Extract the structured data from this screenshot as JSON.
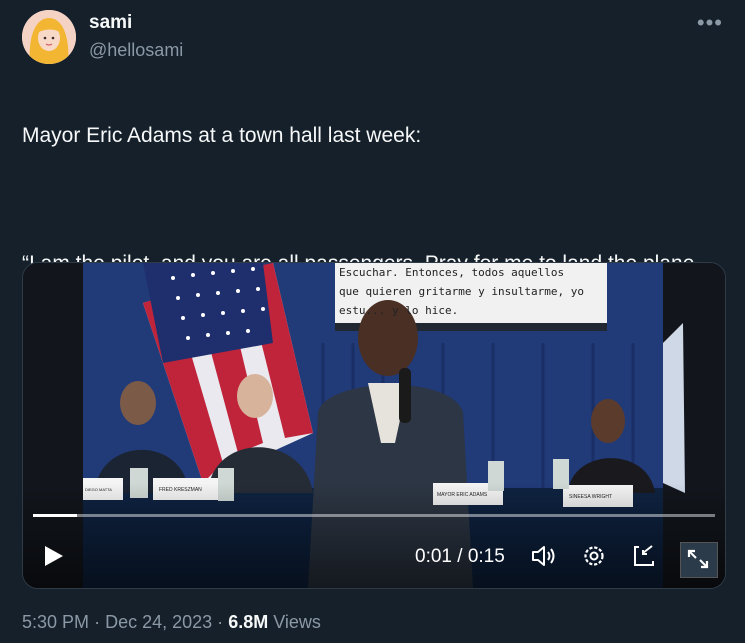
{
  "author": {
    "name": "sami",
    "handle": "@hellosami"
  },
  "tweet": {
    "text_line1": "Mayor Eric Adams at a town hall last week:",
    "text_quote": "“I am the pilot, and you are all passengers. Pray for me to land the plane, cause there’s no parachutes on this plane, we’re all going down together.”"
  },
  "video": {
    "screen_caption_lines": [
      "Escuchar. Entonces, todos aquellos",
      "que quieren gritarme y insultarme, yo",
      "estu... y lo hice."
    ],
    "time_current": "0:01",
    "time_separator": "/",
    "time_total": "0:15",
    "progress": 0.065,
    "nameplates": [
      "DIEGO MATTA",
      "FRED KRESZMAN",
      "MAYOR ERIC ADAMS",
      "SINEESA WRIGHT"
    ]
  },
  "meta": {
    "time": "5:30 PM",
    "date": "Dec 24, 2023",
    "views_count": "6.8M",
    "views_label": "Views",
    "dot": "·"
  },
  "icons": [
    "more-icon",
    "play-icon",
    "volume-icon",
    "settings-icon",
    "pip-icon",
    "fullscreen-icon"
  ]
}
